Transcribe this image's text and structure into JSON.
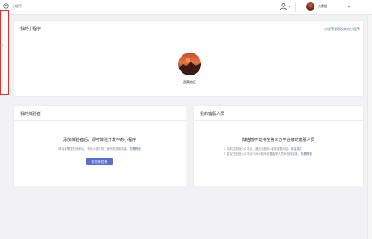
{
  "topbar": {
    "app_name": "小程序",
    "account_name": "大数据"
  },
  "miniapp_card": {
    "title": "我的小程序",
    "link": "小程序管理及其他小程序",
    "app_name": "西藏地区"
  },
  "experience_card": {
    "title": "我的体验者",
    "empty_title": "添加体验者后，即可体验开发中的小程序",
    "empty_desc_prefix": "体验者需要扫码体验，请将小程序的二维码发给体验者。",
    "empty_desc_link": "查看教程",
    "button_label": "添加体验者"
  },
  "service_card": {
    "title": "我的客服人员",
    "empty_title": "微信暂不支持在第三方平台绑定客服人员",
    "rule1_text": "1. 请前往微信公众平台，通过小程序>客服设置添加。",
    "rule1_link": "前往绑定",
    "rule2_text": "2. 建议在微信公众平台中对小程序设置客服人员和在线客服。",
    "rule2_link": "查看教程"
  }
}
